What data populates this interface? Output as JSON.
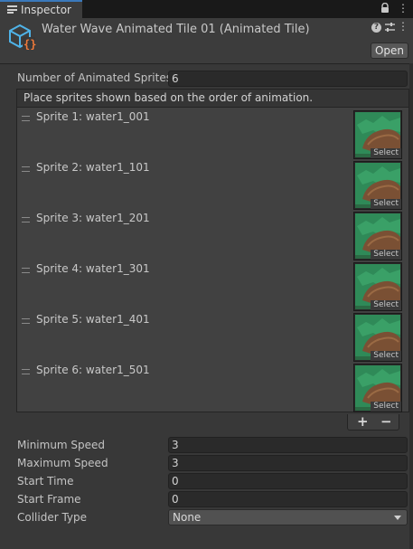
{
  "tab": {
    "label": "Inspector"
  },
  "header": {
    "title": "Water Wave Animated Tile 01 (Animated Tile)",
    "open_label": "Open",
    "help_glyph": "?",
    "menu_glyph": "⋮"
  },
  "count": {
    "label": "Number of Animated Sprites",
    "value": "6"
  },
  "list": {
    "header": "Place sprites shown based on the order of animation.",
    "select_label": "Select",
    "items": [
      {
        "label": "Sprite 1: water1_001"
      },
      {
        "label": "Sprite 2: water1_101"
      },
      {
        "label": "Sprite 3: water1_201"
      },
      {
        "label": "Sprite 4: water1_301"
      },
      {
        "label": "Sprite 5: water1_401"
      },
      {
        "label": "Sprite 6: water1_501"
      }
    ],
    "add_glyph": "+",
    "remove_glyph": "−"
  },
  "fields": {
    "min_speed": {
      "label": "Minimum Speed",
      "value": "3"
    },
    "max_speed": {
      "label": "Maximum Speed",
      "value": "3"
    },
    "start_time": {
      "label": "Start Time",
      "value": "0"
    },
    "start_frame": {
      "label": "Start Frame",
      "value": "0"
    },
    "collider": {
      "label": "Collider Type",
      "value": "None"
    }
  },
  "colors": {
    "tab_accent": "#3a79bb",
    "asset_icon_blue": "#4fb3e8",
    "asset_icon_orange": "#f07a3a"
  }
}
